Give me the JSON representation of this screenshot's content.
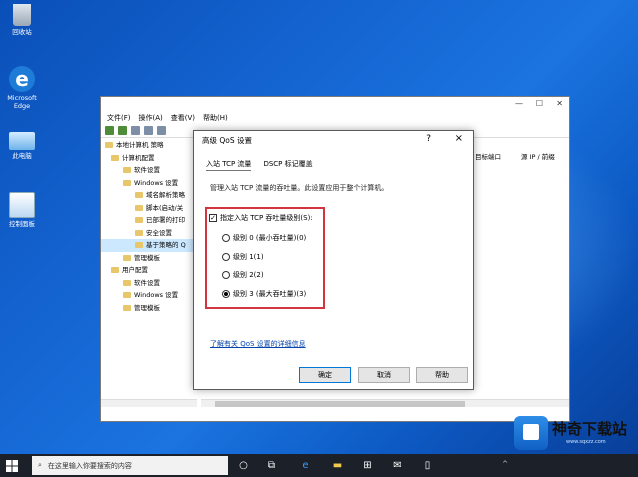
{
  "desktop": {
    "icons": [
      {
        "label": "回收站"
      },
      {
        "label": "Microsoft Edge"
      },
      {
        "label": "此电脑"
      },
      {
        "label": "控制面板"
      }
    ]
  },
  "main_window": {
    "menu": [
      "文件(F)",
      "操作(A)",
      "查看(V)",
      "帮助(H)"
    ],
    "tree": [
      "本地计算机 策略",
      "计算机配置",
      "软件设置",
      "Windows 设置",
      "域名解析策略",
      "脚本(启动/关",
      "已部署的打印",
      "安全设置",
      "基于策略的 Q",
      "管理模板",
      "用户配置",
      "软件设置",
      "Windows 设置",
      "管理模板"
    ],
    "columns": [
      "目标端口",
      "源 IP / 前缀"
    ]
  },
  "dialog": {
    "title": "高级 QoS 设置",
    "help": "?",
    "close": "×",
    "tabs": [
      "入站 TCP 流量",
      "DSCP 标记覆盖"
    ],
    "description": "管理入站 TCP 流量的吞吐量。此设置应用于整个计算机。",
    "checkbox_label": "指定入站 TCP 吞吐量级别(S):",
    "checkbox_mark": "✓",
    "options": [
      {
        "label": "级别 0 (最小吞吐量)(0)",
        "selected": false
      },
      {
        "label": "级别 1(1)",
        "selected": false
      },
      {
        "label": "级别 2(2)",
        "selected": false
      },
      {
        "label": "级别 3 (最大吞吐量)(3)",
        "selected": true
      }
    ],
    "link": "了解有关 QoS 设置的详细信息",
    "ok": "确定",
    "cancel": "取消",
    "helpbtn": "帮助"
  },
  "taskbar": {
    "search_placeholder": "在这里输入你要搜索的内容"
  },
  "watermark": {
    "brand": "神奇下载站",
    "url": "www.sqxzz.com"
  },
  "colors": {
    "highlight_frame": "#d1353f",
    "link": "#0645ad",
    "taskbar": "#1c2028"
  }
}
